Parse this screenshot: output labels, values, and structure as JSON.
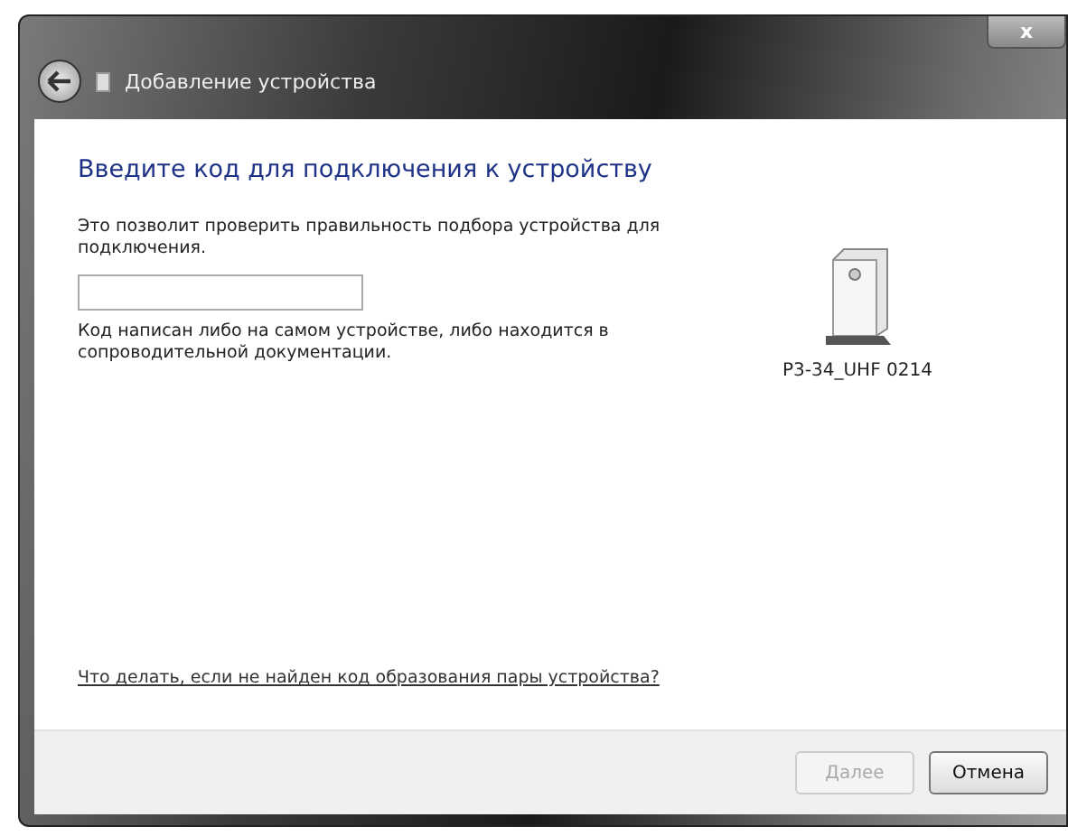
{
  "window": {
    "title": "Добавление устройства",
    "close": "x"
  },
  "heading": "Введите код для подключения к устройству",
  "description": "Это позволит проверить правильность подбора устройства для подключения.",
  "hint": "Код написан либо на самом устройстве, либо находится в сопроводительной документации.",
  "device": {
    "name": "P3-34_UHF 0214"
  },
  "help_link": "Что делать, если не найден код образования пары устройства?",
  "buttons": [
    {
      "label": "Далее",
      "disabled": true
    },
    {
      "label": "Отмена",
      "disabled": false
    }
  ]
}
